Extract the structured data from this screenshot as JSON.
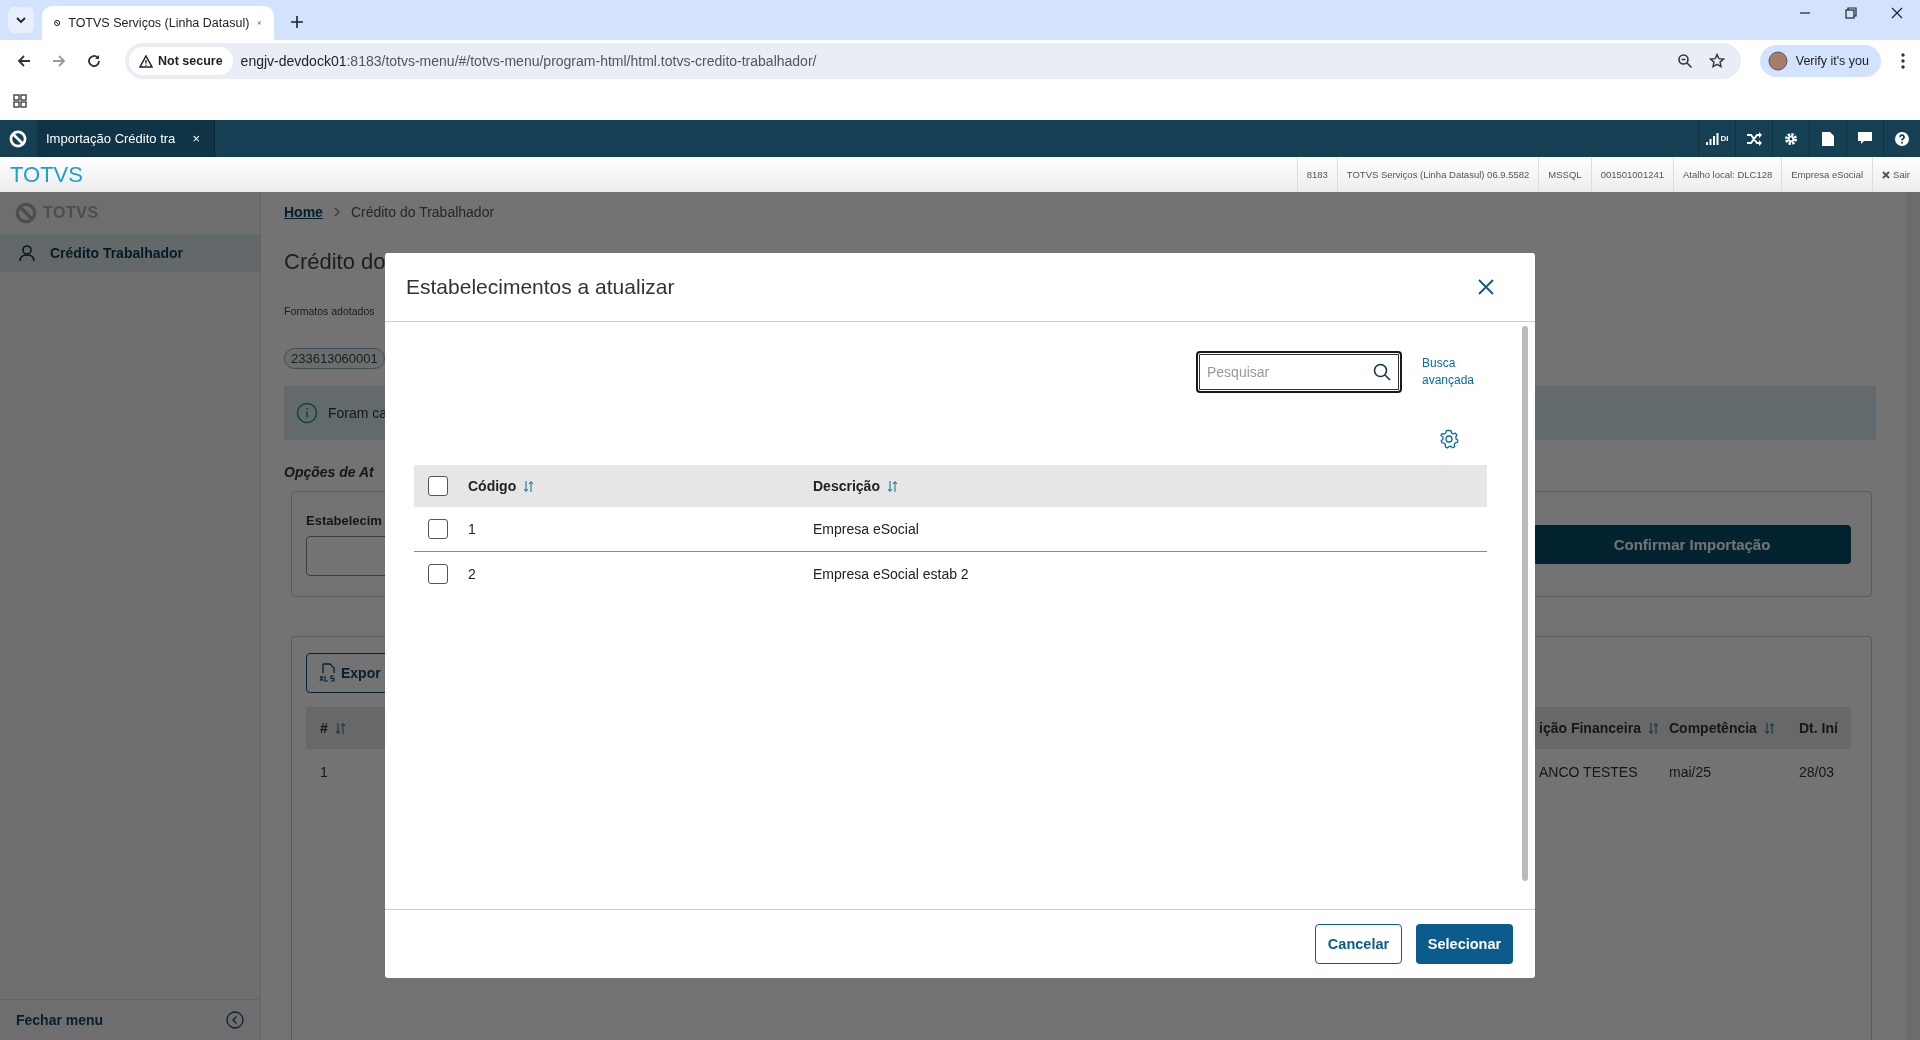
{
  "browser": {
    "tabs": [
      {
        "title": "TOTVS Serviços (Linha Datasul)",
        "selected": true
      }
    ],
    "address": {
      "security": "Not secure",
      "host": "engjv-devdock01",
      "path": ":8183/totvs-menu/#/totvs-menu/program-html/html.totvs-credito-trabalhador/"
    },
    "profile": "Verify it's you"
  },
  "app_header": {
    "tab": {
      "label": "Importação Crédito tra",
      "close": "×"
    },
    "signal_label": "DI"
  },
  "top_bar": {
    "brand": "TOTVS",
    "info": [
      "8183",
      "TOTVS Serviços (Linha Datasul) 06.9.5582",
      "MSSQL",
      "001501001241",
      "Atalho local: DLC128",
      "Empresa eSocial"
    ],
    "exit": "Sair"
  },
  "sidebar": {
    "logo": "TOTVS",
    "items": [
      {
        "label": "Crédito Trabalhador",
        "selected": true
      }
    ],
    "footer": "Fechar menu"
  },
  "page": {
    "breadcrumb": [
      "Home",
      "Crédito do Trabalhador"
    ],
    "title": "Crédito do",
    "formats_note": "Formatos adotados",
    "chip": "233613060001",
    "alert": "Foram ca",
    "section": "Opções de At",
    "field_label": "Estabelecim",
    "confirm_button": "Confirmar Importação",
    "export_button": "Expor",
    "table": {
      "columns": [
        {
          "label": "#",
          "sortable": true
        },
        {
          "label": "ição Financeira",
          "sortable": true
        },
        {
          "label": "Competência",
          "sortable": true
        },
        {
          "label": "Dt. Iní",
          "sortable": false
        }
      ],
      "rows": [
        [
          "1",
          "ANCO TESTES",
          "mai/25",
          "28/03"
        ]
      ]
    }
  },
  "modal": {
    "title": "Estabelecimentos a atualizar",
    "search": {
      "placeholder": "Pesquisar"
    },
    "advanced_search": "Busca avançada",
    "select_all": {
      "checked": false
    },
    "columns": [
      {
        "label": "Código",
        "sortable": true
      },
      {
        "label": "Descrição",
        "sortable": true
      }
    ],
    "rows": [
      {
        "checked": false,
        "cells": [
          "1",
          "Empresa eSocial"
        ]
      },
      {
        "checked": false,
        "cells": [
          "2",
          "Empresa eSocial estab 2"
        ]
      }
    ],
    "buttons": {
      "cancel": "Cancelar",
      "select": "Selecionar"
    }
  }
}
